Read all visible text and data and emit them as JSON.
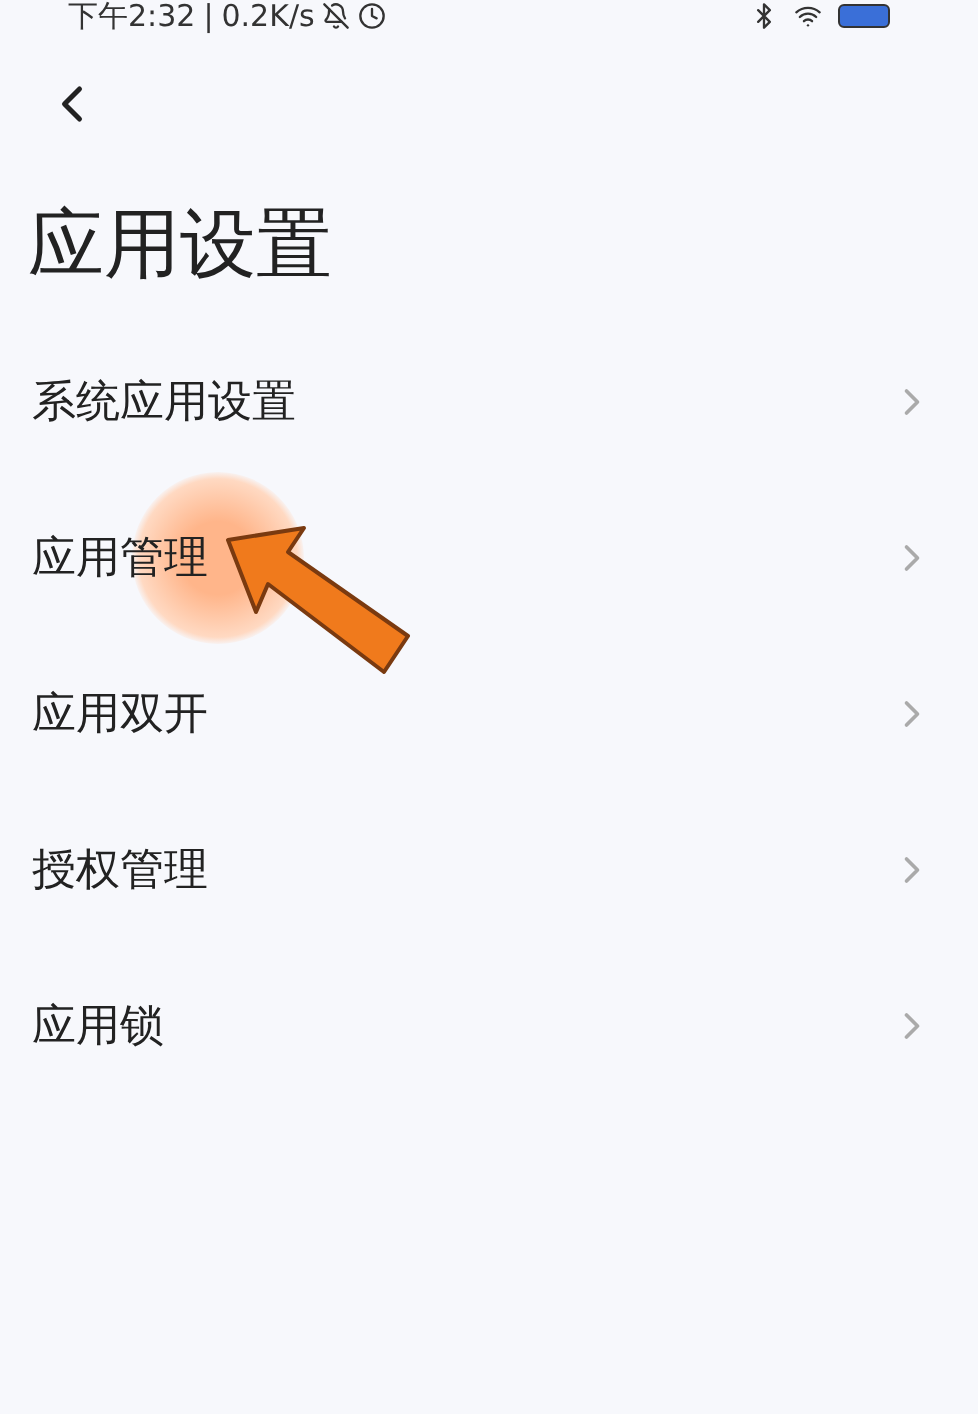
{
  "status_bar": {
    "time": "下午2:32",
    "separator": "|",
    "speed": "0.2K/s"
  },
  "title": "应用设置",
  "items": [
    {
      "label": "系统应用设置",
      "highlighted": false
    },
    {
      "label": "应用管理",
      "highlighted": true
    },
    {
      "label": "应用双开",
      "highlighted": false
    },
    {
      "label": "授权管理",
      "highlighted": false
    },
    {
      "label": "应用锁",
      "highlighted": false
    }
  ]
}
